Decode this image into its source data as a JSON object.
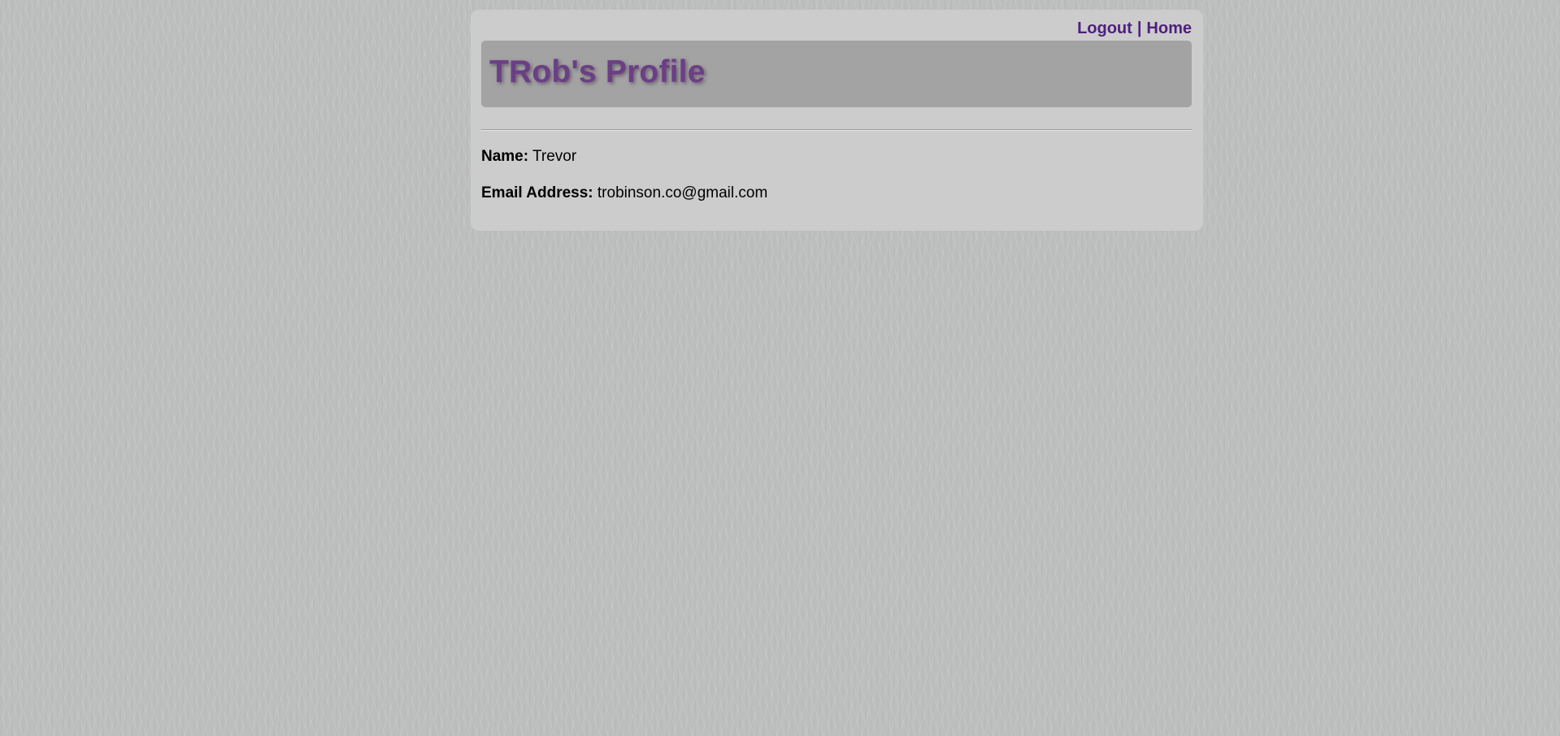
{
  "nav": {
    "logout_label": "Logout",
    "separator": "|",
    "home_label": "Home"
  },
  "header": {
    "title": "TRob's Profile"
  },
  "profile": {
    "name_label": "Name:",
    "name_value": "Trevor",
    "email_label": "Email Address:",
    "email_value": "trobinson.co@gmail.com"
  },
  "colors": {
    "background": "#bdbfbe",
    "panel": "#cccccc",
    "header_bar": "#a3a3a3",
    "title": "#6b3f85",
    "link": "#4e1f7e"
  }
}
